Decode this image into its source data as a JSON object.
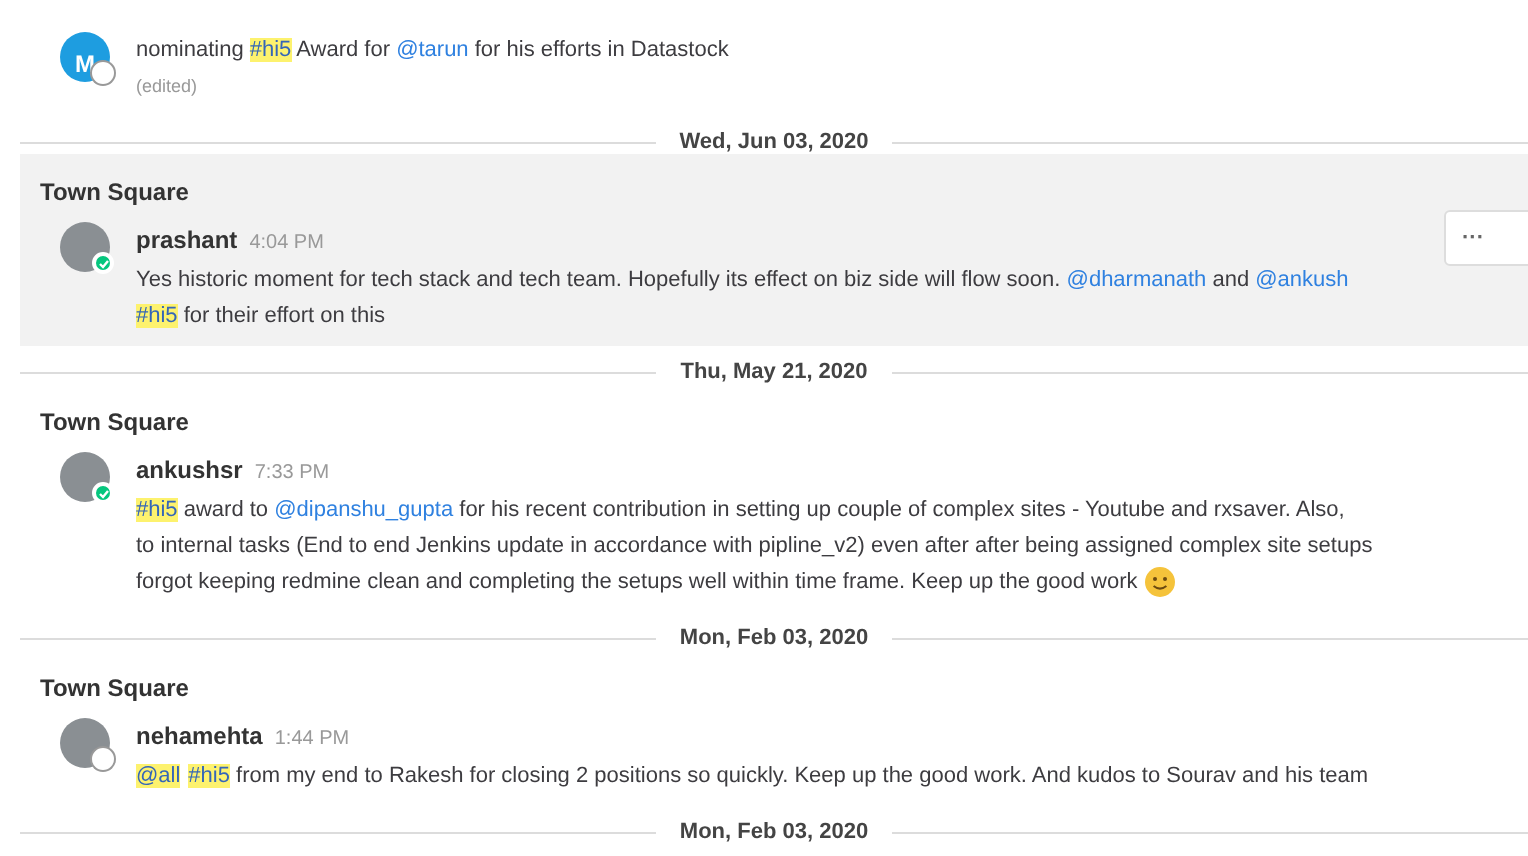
{
  "items": [
    {
      "kind": "message",
      "avatar": {
        "kind": "letter",
        "letter": "M",
        "color": "#1e9de0"
      },
      "online": false,
      "hovered": false,
      "lines": [
        [
          {
            "kind": "text",
            "text": "nominating "
          },
          {
            "kind": "hashtag",
            "text": "#hi5"
          },
          {
            "kind": "text",
            "text": " Award for "
          },
          {
            "kind": "mention",
            "text": "@tarun"
          },
          {
            "kind": "text",
            "text": " for his efforts in Datastock"
          }
        ]
      ],
      "edited": "(edited)"
    },
    {
      "kind": "date",
      "label": "Wed, Jun 03, 2020"
    },
    {
      "kind": "message",
      "channel": "Town Square",
      "avatar": {
        "kind": "photo"
      },
      "user": "prashant",
      "time": "4:04 PM",
      "online": true,
      "hovered": true,
      "lines": [
        [
          {
            "kind": "text",
            "text": "Yes historic moment for tech stack and tech team. Hopefully its effect on biz side will flow soon. "
          },
          {
            "kind": "mention",
            "text": "@dharmanath"
          },
          {
            "kind": "text",
            "text": " and "
          },
          {
            "kind": "mention",
            "text": "@ankush"
          }
        ],
        [
          {
            "kind": "hashtag",
            "text": "#hi5"
          },
          {
            "kind": "text",
            "text": " for their effort on this"
          }
        ]
      ],
      "menu": "···"
    },
    {
      "kind": "date",
      "label": "Thu, May 21, 2020"
    },
    {
      "kind": "message",
      "channel": "Town Square",
      "avatar": {
        "kind": "photo"
      },
      "user": "ankushsr",
      "time": "7:33 PM",
      "online": true,
      "hovered": false,
      "lines": [
        [
          {
            "kind": "hashtag",
            "text": "#hi5"
          },
          {
            "kind": "text",
            "text": " award to "
          },
          {
            "kind": "mention",
            "text": "@dipanshu_gupta"
          },
          {
            "kind": "text",
            "text": " for his recent contribution in setting up couple of complex sites - Youtube and rxsaver. Also,"
          }
        ],
        [
          {
            "kind": "text",
            "text": "to internal tasks (End to end Jenkins update in accordance with pipline_v2) even after after being assigned complex site setups"
          }
        ],
        [
          {
            "kind": "text",
            "text": "forgot keeping redmine clean and completing the setups well within time frame. Keep up the good work "
          },
          {
            "kind": "emoji"
          }
        ]
      ]
    },
    {
      "kind": "date",
      "label": "Mon, Feb 03, 2020"
    },
    {
      "kind": "message",
      "channel": "Town Square",
      "avatar": {
        "kind": "photo"
      },
      "user": "nehamehta",
      "time": "1:44 PM",
      "online": false,
      "hovered": false,
      "lines": [
        [
          {
            "kind": "hashtag",
            "text": "@all"
          },
          {
            "kind": "hashtag",
            "text": "#hi5"
          },
          {
            "kind": "text",
            "text": " from my end to Rakesh for closing 2 positions so quickly. Keep up the good work. And kudos to Sourav and his team"
          }
        ]
      ]
    },
    {
      "kind": "date",
      "label": "Mon, Feb 03, 2020"
    }
  ]
}
